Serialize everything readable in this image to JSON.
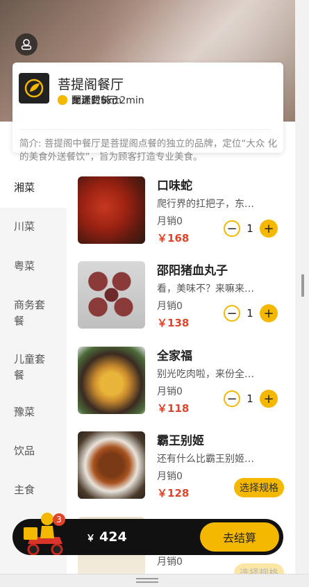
{
  "colors": {
    "accent": "#f5b800",
    "price": "#e0442a",
    "cart_bg": "#111111"
  },
  "header": {
    "avatar_icon": "user-icon"
  },
  "shop": {
    "name": "菩提阁餐厅",
    "logo_icon": "leaf-logo",
    "distance": "距离1.5km",
    "delivery_fee": "配送费6元",
    "eta_label": "预计时长",
    "eta_value": "12min",
    "intro": "简介: 菩提阁中餐厅是菩提阁点餐的独立的品牌，定位“大众 化的美食外送餐饮”，旨为顾客打造专业美食。"
  },
  "categories": [
    {
      "label": "湘菜",
      "active": true
    },
    {
      "label": "川菜"
    },
    {
      "label": "粤菜"
    },
    {
      "label": "商务套餐"
    },
    {
      "label": "儿童套餐"
    },
    {
      "label": "豫菜"
    },
    {
      "label": "饮品"
    },
    {
      "label": "主食"
    }
  ],
  "dishes": [
    {
      "name": "口味蛇",
      "desc": "爬行界的扛把子，东…",
      "sales": "月销0",
      "price": "168",
      "qty": "1"
    },
    {
      "name": "邵阳猪血丸子",
      "desc": "看，美味不？来嘛来…",
      "sales": "月销0",
      "price": "138",
      "qty": "1"
    },
    {
      "name": "全家福",
      "desc": "别光吃肉啦，来份全…",
      "sales": "月销0",
      "price": "118",
      "qty": "1"
    },
    {
      "name": "霸王别姬",
      "desc": "还有什么比霸王别姬…",
      "sales": "月销0",
      "price": "128",
      "spec_label": "选择规格"
    },
    {
      "name": "",
      "desc": "",
      "sales": "月销0",
      "price": "",
      "spec_label": "选择规格"
    }
  ],
  "labels": {
    "currency": "￥",
    "minus": "−",
    "plus": "+"
  },
  "cart": {
    "badge": "3",
    "currency": "￥",
    "total": "424",
    "checkout": "去结算"
  }
}
